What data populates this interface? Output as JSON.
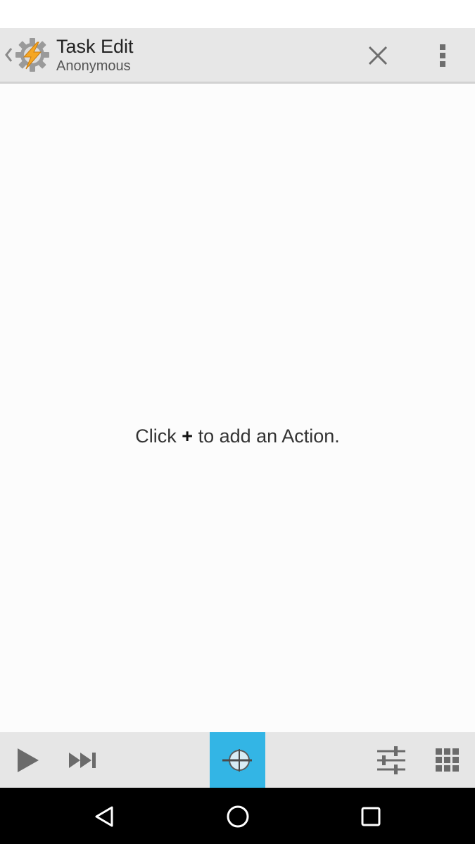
{
  "action_bar": {
    "title": "Task Edit",
    "subtitle": "Anonymous",
    "icons": {
      "back": "chevron-left-icon",
      "app": "tasker-gear-bolt-icon",
      "close": "close-icon",
      "overflow": "more-vert-icon"
    }
  },
  "content": {
    "hint_prefix": "Click",
    "hint_plus": "+",
    "hint_suffix": "to add an Action."
  },
  "bottom_bar": {
    "icons": [
      "play-icon",
      "skip-next-icon",
      "target-icon",
      "tune-icon",
      "grid-icon"
    ],
    "accent_color": "#33b5e5"
  },
  "nav_bar": {
    "icons": [
      "nav-back-icon",
      "nav-home-icon",
      "nav-recent-icon"
    ]
  }
}
